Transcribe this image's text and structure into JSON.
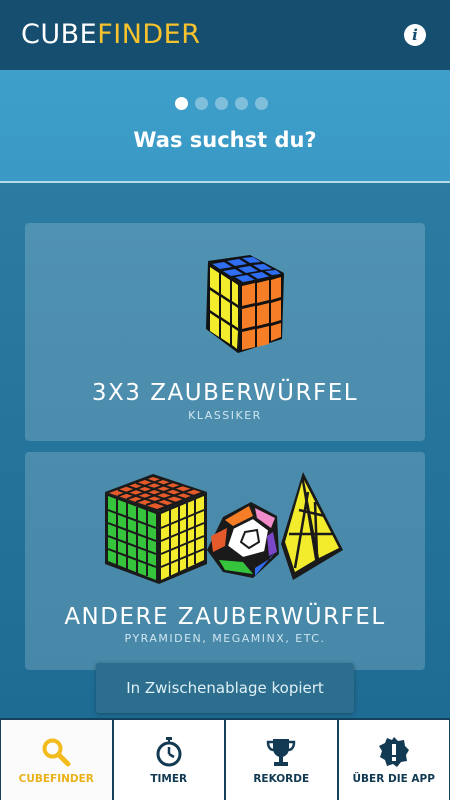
{
  "appbar": {
    "title_part1": "CUBE",
    "title_part2": "FINDER",
    "info_label": "i"
  },
  "pager": {
    "count": 5,
    "active_index": 0
  },
  "hero": {
    "question": "Was suchst du?"
  },
  "cards": [
    {
      "title": "3X3 ZAUBERWÜRFEL",
      "subtitle": "KLASSIKER"
    },
    {
      "title": "ANDERE ZAUBERWÜRFEL",
      "subtitle": "PYRAMIDEN, MEGAMINX, ETC."
    }
  ],
  "toast": {
    "text": "In Zwischenablage kopiert"
  },
  "nav": {
    "items": [
      {
        "label": "CUBEFINDER",
        "icon": "search-icon",
        "active": true
      },
      {
        "label": "TIMER",
        "icon": "stopwatch-icon",
        "active": false
      },
      {
        "label": "REKORDE",
        "icon": "trophy-icon",
        "active": false
      },
      {
        "label": "ÜBER DIE APP",
        "icon": "warning-badge-icon",
        "active": false
      }
    ]
  },
  "colors": {
    "appbar": "#154e6f",
    "accent": "#f6c22e",
    "hero": "#3e9fcb",
    "content": "#2b7ba2",
    "nav_bg": "#15415c"
  }
}
